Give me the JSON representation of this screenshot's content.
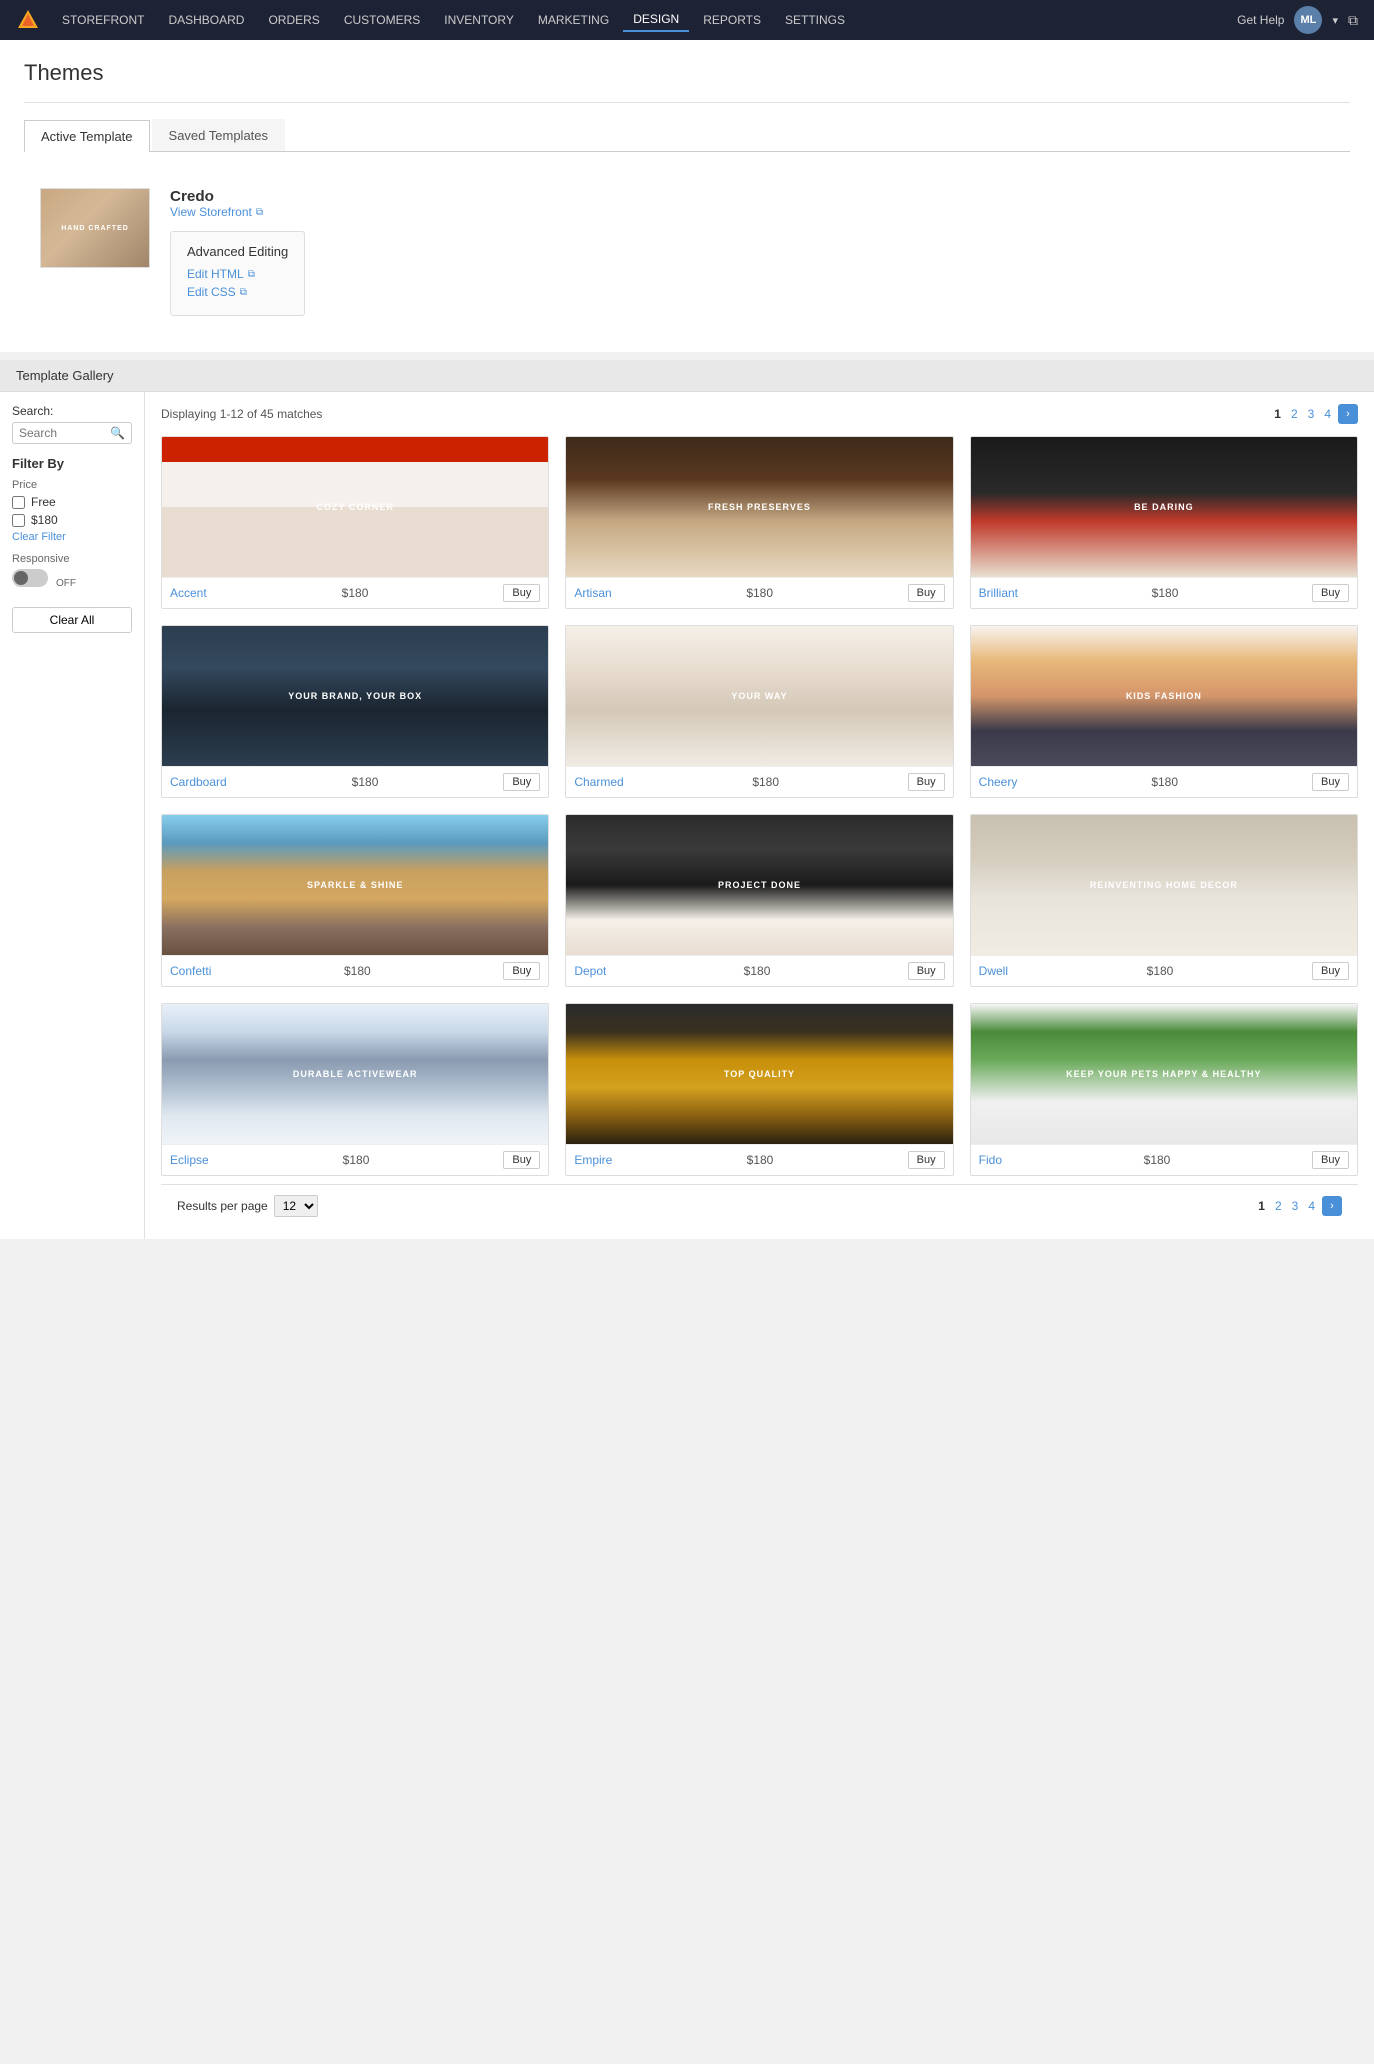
{
  "nav": {
    "logo": "triangle-logo",
    "items": [
      {
        "label": "STOREFRONT",
        "active": false
      },
      {
        "label": "DASHBOARD",
        "active": false
      },
      {
        "label": "ORDERS",
        "active": false
      },
      {
        "label": "CUSTOMERS",
        "active": false
      },
      {
        "label": "INVENTORY",
        "active": false
      },
      {
        "label": "MARKETING",
        "active": false
      },
      {
        "label": "DESIGN",
        "active": true
      },
      {
        "label": "REPORTS",
        "active": false
      },
      {
        "label": "SETTINGS",
        "active": false
      }
    ],
    "help_label": "Get Help",
    "avatar_initials": "ML",
    "external_icon": "⧉"
  },
  "page": {
    "title": "Themes"
  },
  "tabs": [
    {
      "label": "Active Template",
      "active": true
    },
    {
      "label": "Saved Templates",
      "active": false
    }
  ],
  "active_template": {
    "theme_name": "Credo",
    "view_storefront_label": "View Storefront",
    "advanced_editing_title": "Advanced Editing",
    "edit_html_label": "Edit HTML",
    "edit_css_label": "Edit CSS",
    "thumb_text": "HAND CRAFTED"
  },
  "gallery": {
    "section_title": "Template Gallery",
    "search_label": "Search:",
    "search_placeholder": "Search",
    "filter_title": "Filter By",
    "price_label": "Price",
    "price_free_label": "Free",
    "price_paid_label": "$180",
    "clear_filter_label": "Clear Filter",
    "responsive_label": "Responsive",
    "toggle_off": "OFF",
    "clear_all_label": "Clear All",
    "display_count": "Displaying 1-12 of 45 matches",
    "pagination": [
      "1",
      "2",
      "3",
      "4"
    ],
    "per_page_label": "Results per page",
    "per_page_value": "12",
    "buy_label": "Buy",
    "themes": [
      {
        "name": "Accent",
        "price": "$180",
        "thumb_class": "thumb-accent",
        "overlay_text": "COZY CORNER"
      },
      {
        "name": "Artisan",
        "price": "$180",
        "thumb_class": "thumb-artisan",
        "overlay_text": "Fresh Preserves"
      },
      {
        "name": "Brilliant",
        "price": "$180",
        "thumb_class": "thumb-brilliant",
        "overlay_text": "BE DARING"
      },
      {
        "name": "Cardboard",
        "price": "$180",
        "thumb_class": "thumb-cardboard",
        "overlay_text": "YOUR BRAND, YOUR BOX"
      },
      {
        "name": "Charmed",
        "price": "$180",
        "thumb_class": "thumb-charmed",
        "overlay_text": "YOUR Way"
      },
      {
        "name": "Cheery",
        "price": "$180",
        "thumb_class": "thumb-cheery",
        "overlay_text": "KIDS FASHION"
      },
      {
        "name": "Confetti",
        "price": "$180",
        "thumb_class": "thumb-confetti",
        "overlay_text": "SPARKLE & SHINE"
      },
      {
        "name": "Depot",
        "price": "$180",
        "thumb_class": "thumb-depot",
        "overlay_text": "PROJECT DONE"
      },
      {
        "name": "Dwell",
        "price": "$180",
        "thumb_class": "thumb-dwell",
        "overlay_text": "Reinventing home decor"
      },
      {
        "name": "Eclipse",
        "price": "$180",
        "thumb_class": "thumb-eclipse",
        "overlay_text": "Durable Activewear"
      },
      {
        "name": "Empire",
        "price": "$180",
        "thumb_class": "thumb-empire",
        "overlay_text": "TOP QUALITY"
      },
      {
        "name": "Fido",
        "price": "$180",
        "thumb_class": "thumb-fido",
        "overlay_text": "Keep Your Pets Happy & Healthy"
      }
    ]
  }
}
